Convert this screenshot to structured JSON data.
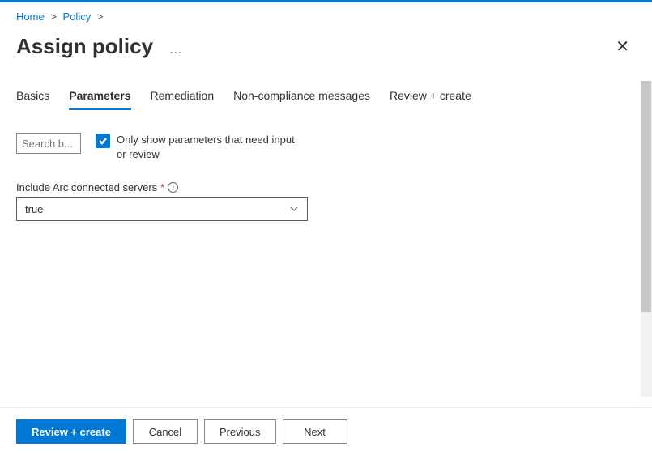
{
  "breadcrumb": {
    "items": [
      {
        "label": "Home"
      },
      {
        "label": "Policy"
      }
    ]
  },
  "header": {
    "title": "Assign policy"
  },
  "tabs": [
    {
      "label": "Basics",
      "active": false
    },
    {
      "label": "Parameters",
      "active": true
    },
    {
      "label": "Remediation",
      "active": false
    },
    {
      "label": "Non-compliance messages",
      "active": false
    },
    {
      "label": "Review + create",
      "active": false
    }
  ],
  "search": {
    "placeholder": "Search b..."
  },
  "checkbox": {
    "checked": true,
    "label": "Only show parameters that need input or review"
  },
  "parameter": {
    "label": "Include Arc connected servers",
    "required_mark": "*",
    "value": "true"
  },
  "footer": {
    "primary": "Review + create",
    "cancel": "Cancel",
    "previous": "Previous",
    "next": "Next"
  }
}
